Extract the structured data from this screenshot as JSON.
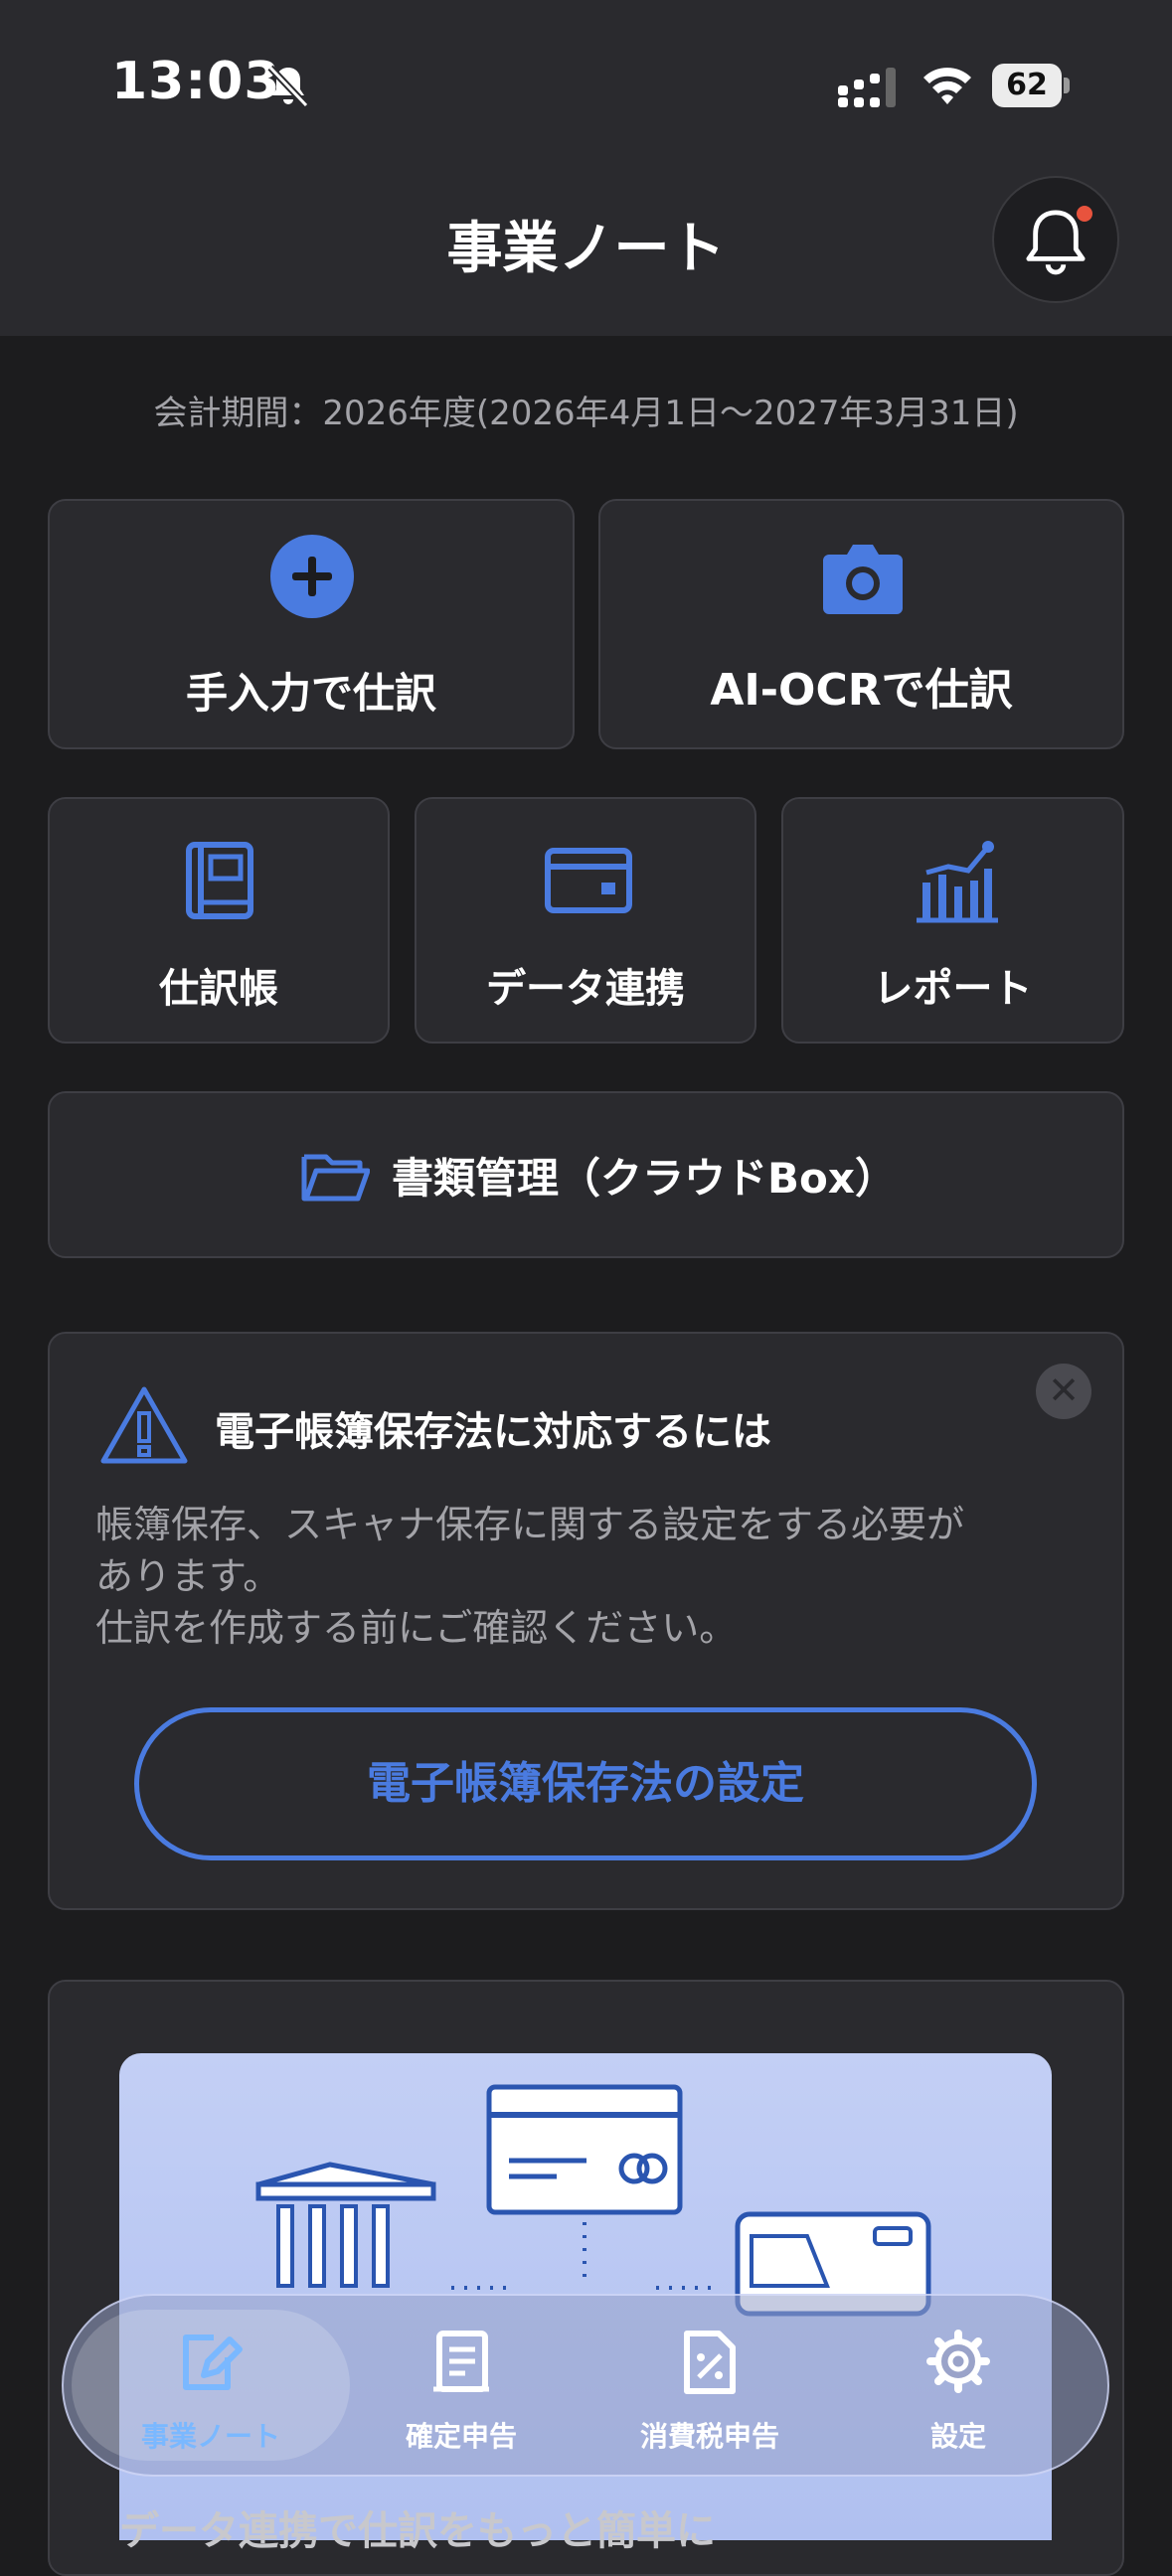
{
  "status_bar": {
    "time": "13:03",
    "battery": "62"
  },
  "header": {
    "title": "事業ノート"
  },
  "fiscal_period": "会計期間：2026年度(2026年4月1日〜2027年3月31日)",
  "actions": {
    "manual_entry": "手入力で仕訳",
    "ai_ocr": "AI-OCRで仕訳",
    "journal": "仕訳帳",
    "data_link": "データ連携",
    "report": "レポート",
    "documents": "書類管理（クラウドBox）"
  },
  "notice": {
    "title": "電子帳簿保存法に対応するには",
    "body_line1": "帳簿保存、スキャナ保存に関する設定をする必要が",
    "body_line2": "あります。",
    "body_line3": "仕訳を作成する前にご確認ください。",
    "button": "電子帳簿保存法の設定"
  },
  "promo": {
    "text": "データ連携で仕訳をもっと簡単に"
  },
  "tabs": [
    {
      "label": "事業ノート",
      "icon": "note-edit-icon",
      "active": true
    },
    {
      "label": "確定申告",
      "icon": "receipt-icon",
      "active": false
    },
    {
      "label": "消費税申告",
      "icon": "tax-percent-icon",
      "active": false
    },
    {
      "label": "設定",
      "icon": "gear-icon",
      "active": false
    }
  ],
  "colors": {
    "accent": "#4a7be0",
    "active_tab": "#7ab8ff",
    "notification_dot": "#e8533d"
  }
}
